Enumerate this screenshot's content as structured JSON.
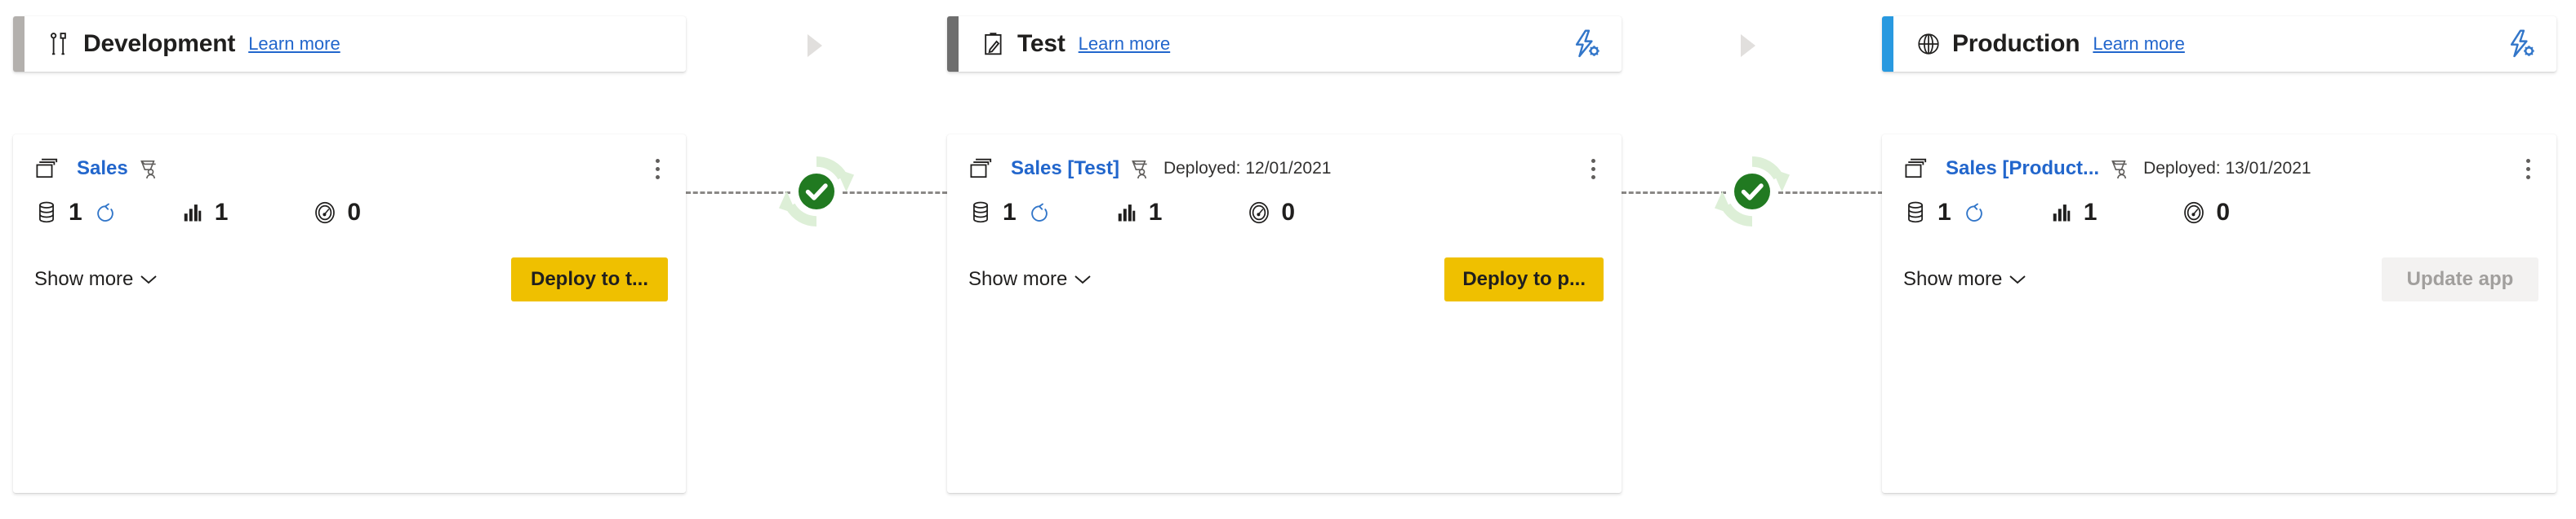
{
  "colors": {
    "dev_accent": "#b3b0ad",
    "test_accent": "#6e6e6e",
    "prod_accent": "#2899E0",
    "link": "#2266cc",
    "cta": "#EFC000",
    "cta_disabled_bg": "#f3f2f1",
    "cta_disabled_text": "#a19f9d",
    "sync_ring": "#DDEFD7",
    "check_green": "#217A21",
    "dash": "#8a8886",
    "arrow": "#e1dfdd"
  },
  "stages": [
    {
      "id": "development",
      "title": "Development",
      "learn_more": "Learn more",
      "header_icon": "tools-icon",
      "accent": "#b3b0ad",
      "has_rules_icon": false,
      "rules_icon": "deployment-rules-icon",
      "app": {
        "name": "Sales",
        "app_icon": "workspace-icon",
        "share_icon": "shared-with-me-icon",
        "deployed_label": "",
        "more_menu": "more-options"
      },
      "metrics": [
        {
          "icon": "dataset-icon",
          "value": "1",
          "refresh_icon": "refresh-icon",
          "has_refresh": true
        },
        {
          "icon": "report-icon",
          "value": "1",
          "has_refresh": false
        },
        {
          "icon": "dashboard-icon",
          "value": "0",
          "has_refresh": false
        }
      ],
      "footer": {
        "show_more": "Show more",
        "chevron": "chevron-down-icon",
        "cta_label": "Deploy to t...",
        "cta_state": "primary"
      }
    },
    {
      "id": "test",
      "title": "Test",
      "learn_more": "Learn more",
      "header_icon": "clipboard-icon",
      "accent": "#6e6e6e",
      "has_rules_icon": true,
      "rules_icon": "deployment-rules-icon",
      "app": {
        "name": "Sales [Test]",
        "app_icon": "workspace-icon",
        "share_icon": "shared-with-me-icon",
        "deployed_label": "Deployed: 12/01/2021",
        "more_menu": "more-options"
      },
      "metrics": [
        {
          "icon": "dataset-icon",
          "value": "1",
          "refresh_icon": "refresh-icon",
          "has_refresh": true
        },
        {
          "icon": "report-icon",
          "value": "1",
          "has_refresh": false
        },
        {
          "icon": "dashboard-icon",
          "value": "0",
          "has_refresh": false
        }
      ],
      "footer": {
        "show_more": "Show more",
        "chevron": "chevron-down-icon",
        "cta_label": "Deploy to p...",
        "cta_state": "primary"
      }
    },
    {
      "id": "production",
      "title": "Production",
      "learn_more": "Learn more",
      "header_icon": "globe-icon",
      "accent": "#2899E0",
      "has_rules_icon": true,
      "rules_icon": "deployment-rules-icon",
      "app": {
        "name": "Sales [Product...",
        "app_icon": "workspace-icon",
        "share_icon": "shared-with-me-icon",
        "deployed_label": "Deployed: 13/01/2021",
        "more_menu": "more-options"
      },
      "metrics": [
        {
          "icon": "dataset-icon",
          "value": "1",
          "refresh_icon": "refresh-icon",
          "has_refresh": true
        },
        {
          "icon": "report-icon",
          "value": "1",
          "has_refresh": false
        },
        {
          "icon": "dashboard-icon",
          "value": "0",
          "has_refresh": false
        }
      ],
      "footer": {
        "show_more": "Show more",
        "chevron": "chevron-down-icon",
        "cta_label": "Update app",
        "cta_state": "disabled"
      }
    }
  ],
  "connectors": [
    {
      "id": "dev-test",
      "status_icon": "compare-success-icon",
      "sync_icon": "sync-arrows-icon"
    },
    {
      "id": "test-prod",
      "status_icon": "compare-success-icon",
      "sync_icon": "sync-arrows-icon"
    }
  ],
  "stage_arrows": [
    {
      "id": "arrow-dev-test",
      "icon": "triangle-right-icon"
    },
    {
      "id": "arrow-test-prod",
      "icon": "triangle-right-icon"
    }
  ]
}
